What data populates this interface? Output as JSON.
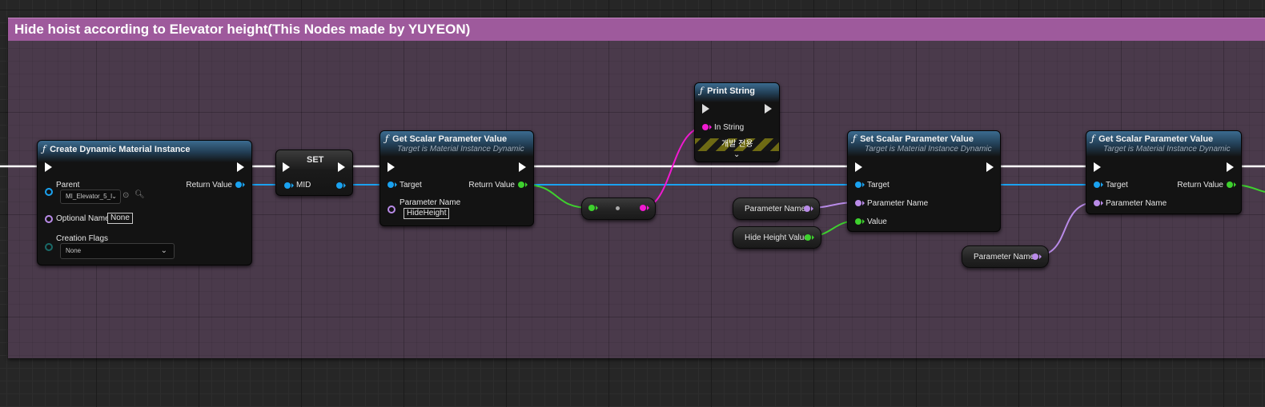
{
  "comment": {
    "title": "Hide hoist according to Elevator height(This Nodes made by YUYEON)",
    "color": "#9e5a9c"
  },
  "pin_colors": {
    "exec": "#ffffff",
    "object": "#1aa2f0",
    "float": "#3ed12e",
    "string": "#f01ad0",
    "name": "#b98be8"
  },
  "nodes": {
    "create_dmi": {
      "icon": "function-icon",
      "title": "Create Dynamic Material Instance",
      "parent_label": "Parent",
      "parent_value": "MI_Elevator_5_I",
      "return_label": "Return Value",
      "optional_name_label": "Optional Name",
      "optional_name_value": "None",
      "creation_flags_label": "Creation Flags",
      "creation_flags_value": "None"
    },
    "set": {
      "title": "SET",
      "mid_label": "MID"
    },
    "get_scalar_1": {
      "icon": "function-icon",
      "title": "Get Scalar Parameter Value",
      "subtitle": "Target is Material Instance Dynamic",
      "target_label": "Target",
      "return_label": "Return Value",
      "param_label": "Parameter Name",
      "param_value": "HideHeight"
    },
    "print_string": {
      "icon": "function-icon",
      "title": "Print String",
      "in_string_label": "In String",
      "dev_only_label": "개발 전용"
    },
    "set_scalar": {
      "icon": "function-icon",
      "title": "Set Scalar Parameter Value",
      "subtitle": "Target is Material Instance Dynamic",
      "target_label": "Target",
      "param_label": "Parameter Name",
      "value_label": "Value"
    },
    "get_scalar_2": {
      "icon": "function-icon",
      "title": "Get Scalar Parameter Value",
      "subtitle": "Target is Material Instance Dynamic",
      "target_label": "Target",
      "return_label": "Return Value",
      "param_label": "Parameter Name"
    }
  },
  "variables": {
    "param_name_1": "Parameter Name",
    "hide_height_value": "Hide Height Value",
    "param_name_2": "Parameter Name"
  }
}
